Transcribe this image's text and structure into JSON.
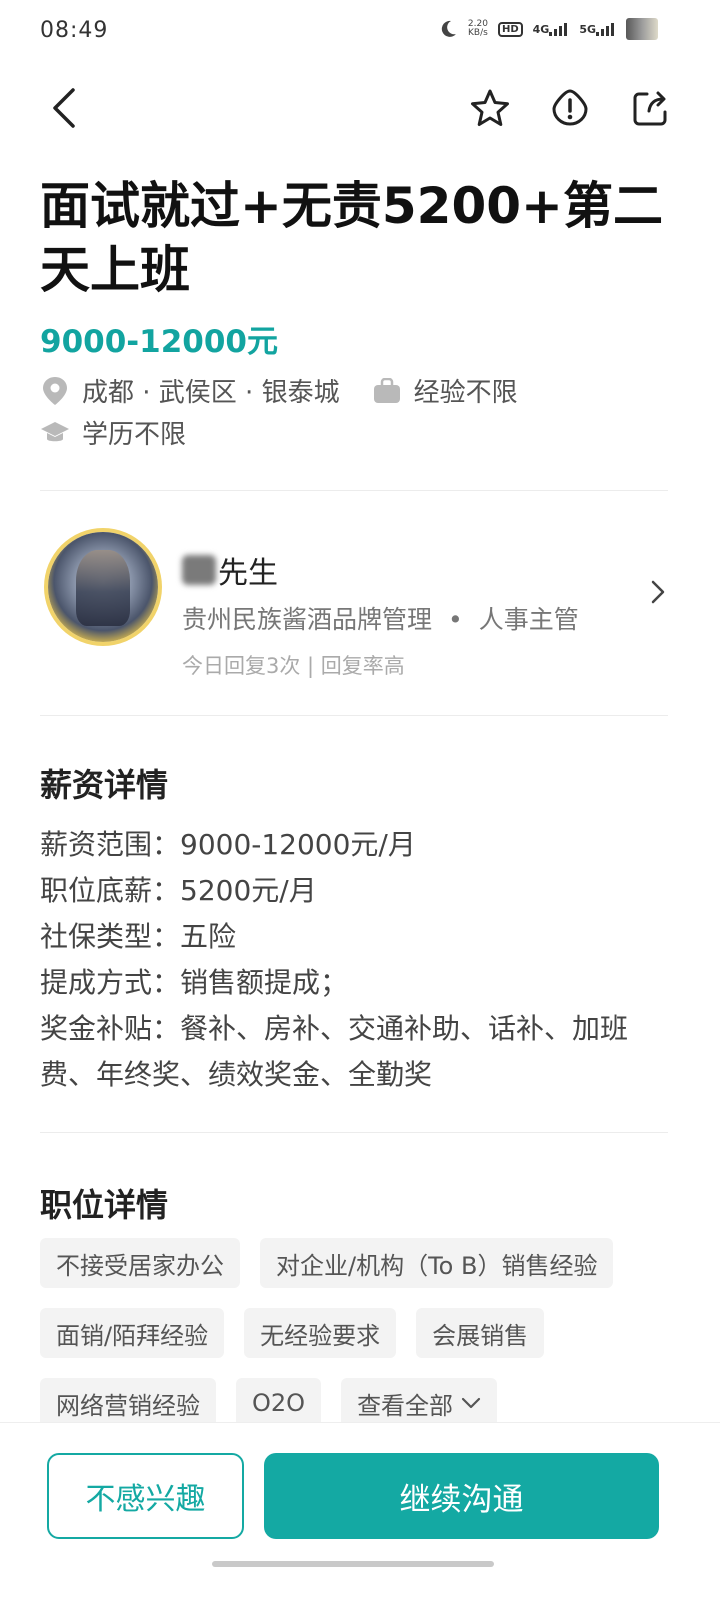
{
  "status_bar": {
    "time": "08:49",
    "net_speed_value": "2.20",
    "net_speed_unit": "KB/s",
    "hd_label": "HD",
    "signal_1": "4G",
    "signal_2": "5G"
  },
  "job": {
    "title": "面试就过+无责5200+第二天上班",
    "salary": "9000-12000元",
    "location": "成都 · 武侯区 · 银泰城",
    "experience": "经验不限",
    "education": "学历不限"
  },
  "recruiter": {
    "name_suffix": "先生",
    "company": "贵州民族酱酒品牌管理",
    "dot": "•",
    "position": "人事主管",
    "reply_info": "今日回复3次 | 回复率高"
  },
  "salary_section": {
    "title": "薪资详情",
    "items": [
      "薪资范围：9000-12000元/月",
      "职位底薪：5200元/月",
      "社保类型：五险",
      "提成方式：销售额提成；",
      "奖金补贴：餐补、房补、交通补助、话补、加班费、年终奖、绩效奖金、全勤奖"
    ]
  },
  "job_section": {
    "title": "职位详情",
    "tags_row1": [
      "不接受居家办公",
      "对企业/机构（To B）销售经验"
    ],
    "tags_row2": [
      "面销/陌拜经验",
      "无经验要求",
      "会展销售"
    ],
    "tags_row3": [
      "网络营销经验",
      "O2O"
    ],
    "view_all": "查看全部"
  },
  "actions": {
    "not_interested": "不感兴趣",
    "continue_chat": "继续沟通"
  },
  "colors": {
    "accent": "#14a9a3",
    "salary": "#12a4a0"
  }
}
